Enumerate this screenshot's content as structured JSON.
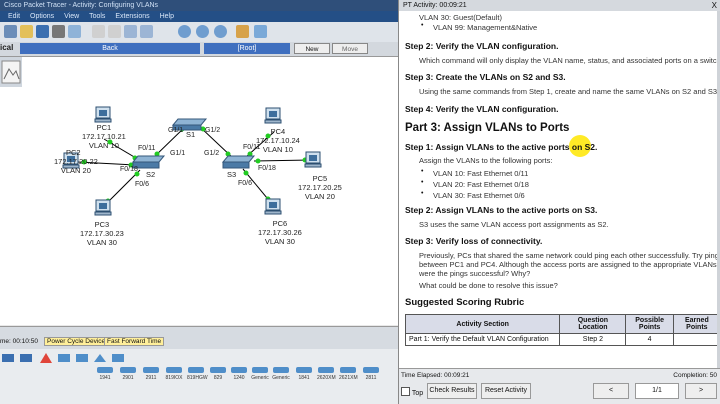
{
  "pt": {
    "title": "Cisco Packet Tracer - Activity: Configuring VLANs",
    "menu": [
      "Edit",
      "Options",
      "View",
      "Tools",
      "Extensions",
      "Help"
    ],
    "nav": {
      "logical": "ical",
      "back": "Back",
      "root": "[Root]",
      "new_cluster": "New Cluster",
      "move_object": "Move Object"
    },
    "status": {
      "time": "me: 00:10:50",
      "power_cycle": "Power Cycle Devices",
      "fast_forward": "Fast Forward Time"
    },
    "devices": [
      "1941",
      "2901",
      "2911",
      "819IOX",
      "819HGW",
      "829",
      "1240",
      "Generic",
      "Generic",
      "1841",
      "2620XM",
      "2621XM",
      "2811"
    ],
    "topology": {
      "pc1": {
        "name": "PC1",
        "ip": "172.17.10.21",
        "vlan": "VLAN 10"
      },
      "pc2": {
        "name": "PC2",
        "ip": "172.17.20.22",
        "vlan": "VLAN 20"
      },
      "pc3": {
        "name": "PC3",
        "ip": "172.17.30.23",
        "vlan": "VLAN 30"
      },
      "pc4": {
        "name": "PC4",
        "ip": "172.17.10.24",
        "vlan": "VLAN 10"
      },
      "pc5": {
        "name": "PC5",
        "ip": "172.17.20.25",
        "vlan": "VLAN 20"
      },
      "pc6": {
        "name": "PC6",
        "ip": "172.17.30.26",
        "vlan": "VLAN 30"
      },
      "s1": "S1",
      "s2": "S2",
      "s3": "S3",
      "ports": {
        "s1_left": "G1/1",
        "s1_right": "G1/2",
        "s2_up": "G1/1",
        "s2_f011": "F0/11",
        "s2_f018": "F0/18",
        "s2_f06": "F0/6",
        "s3_up": "G1/2",
        "s3_f011": "F0/11",
        "s3_f018": "F0/18",
        "s3_f06": "F0/6"
      }
    }
  },
  "activity": {
    "title": "PT Activity: 00:09:21",
    "close": "X",
    "lines": {
      "vlan30": "VLAN 30: Guest(Default)",
      "vlan99": "VLAN 99: Management&Native",
      "s2_h": "Step 2:  Verify the VLAN configuration.",
      "s2_p": "Which command will only display the VLAN name, status, and associated ports on a switch?",
      "s3_h": "Step 3:  Create the VLANs on S2 and S3.",
      "s3_p": "Using the same commands from Step 1, create and name the same VLANs on S2 and S3.",
      "s4_h": "Step 4:  Verify the VLAN configuration.",
      "part3": "Part 3:  Assign VLANs to Ports",
      "p3s1_h": "Step 1:  Assign VLANs to the active ports on S2.",
      "p3s1_p": "Assign the VLANs to the following ports:",
      "b1": "VLAN 10: Fast Ethernet 0/11",
      "b2": "VLAN 20: Fast Ethernet 0/18",
      "b3": "VLAN 30: Fast Ethernet 0/6",
      "p3s2_h": "Step 2:  Assign VLANs to the active ports on S3.",
      "p3s2_p": "S3 uses the same VLAN access port assignments as S2.",
      "p3s3_h": "Step 3:  Verify loss of connectivity.",
      "p3s3_p1": "Previously, PCs that shared the same network could ping each other successfully. Try pinging",
      "p3s3_p2": "between PC1 and PC4. Although the access ports are assigned to the appropriate VLANs,",
      "p3s3_p3": "were the pings successful? Why?",
      "p3s3_p4": "What could be done to resolve this issue?",
      "rubric": "Suggested Scoring Rubric"
    },
    "table": {
      "headers": [
        "Activity Section",
        "Question Location",
        "Possible Points",
        "Earned Points"
      ],
      "row": [
        "Part 1: Verify the Default VLAN Configuration",
        "Step 2",
        "4",
        ""
      ]
    },
    "footer": {
      "elapsed": "Time Elapsed: 00:09:21",
      "completion": "Completion: 50",
      "top": "Top",
      "check": "Check Results",
      "reset": "Reset Activity",
      "prev": "<",
      "page": "1/1",
      "next": ">"
    }
  }
}
